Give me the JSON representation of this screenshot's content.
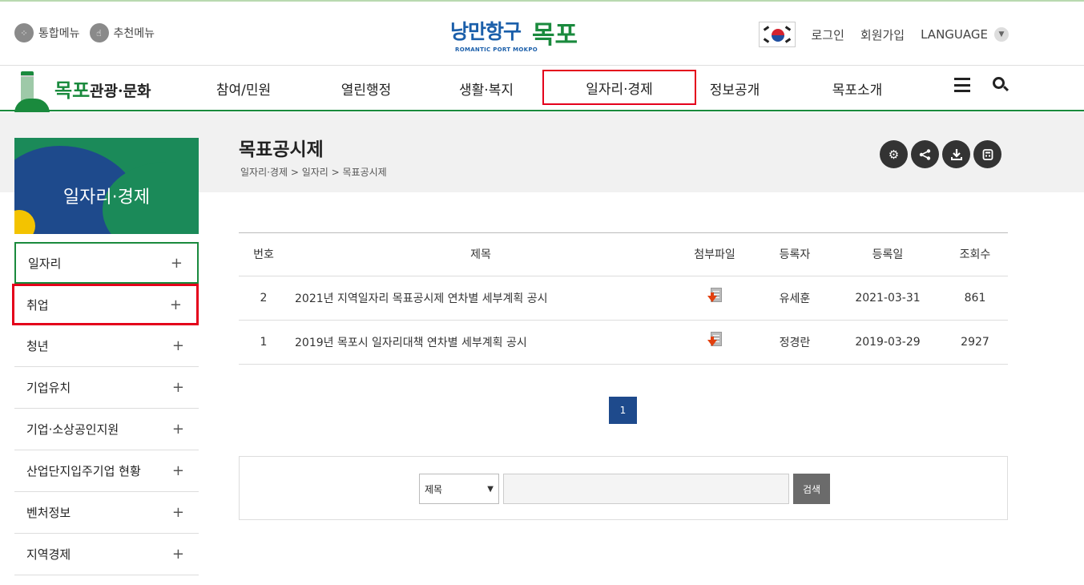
{
  "util": {
    "integrated_menu": "통합메뉴",
    "recommended_menu": "추천메뉴",
    "login": "로그인",
    "signup": "회원가입",
    "language": "LANGUAGE"
  },
  "logo": {
    "script": "낭만항구",
    "name": "목포",
    "sub": "ROMANTIC PORT MOKPO"
  },
  "gnb": {
    "logo_name": "목포",
    "logo_text": "관광·문화",
    "items": [
      {
        "label": "참여/민원"
      },
      {
        "label": "열린행정"
      },
      {
        "label": "생활·복지"
      },
      {
        "label": "일자리·경제"
      },
      {
        "label": "정보공개"
      },
      {
        "label": "목포소개"
      }
    ],
    "active_index": 3
  },
  "sidebar": {
    "banner_title": "일자리·경제",
    "items": [
      {
        "label": "일자리"
      },
      {
        "label": "취업"
      },
      {
        "label": "청년"
      },
      {
        "label": "기업유치"
      },
      {
        "label": "기업·소상공인지원"
      },
      {
        "label": "산업단지입주기업 현황"
      },
      {
        "label": "벤처정보"
      },
      {
        "label": "지역경제"
      }
    ],
    "plus": "+"
  },
  "page": {
    "title": "목표공시제",
    "breadcrumb": "일자리·경제 > 일자리 > 목표공시제"
  },
  "tools": [
    "gear-icon",
    "share-icon",
    "download-icon",
    "print-icon"
  ],
  "board": {
    "headers": [
      "번호",
      "제목",
      "첨부파일",
      "등록자",
      "등록일",
      "조회수"
    ],
    "rows": [
      {
        "no": "2",
        "title": "2021년 지역일자리 목표공시제 연차별 세부계획 공시",
        "author": "유세훈",
        "date": "2021-03-31",
        "views": "861"
      },
      {
        "no": "1",
        "title": "2019년 목포시 일자리대책 연차별 세부계획 공시",
        "author": "정경란",
        "date": "2019-03-29",
        "views": "2927"
      }
    ]
  },
  "pager": {
    "current": "1"
  },
  "search": {
    "select_value": "제목",
    "input_value": "",
    "button": "검색"
  },
  "colors": {
    "green": "#1a8a3d",
    "navy": "#1e4a8c",
    "highlight_red": "#e4001b"
  }
}
